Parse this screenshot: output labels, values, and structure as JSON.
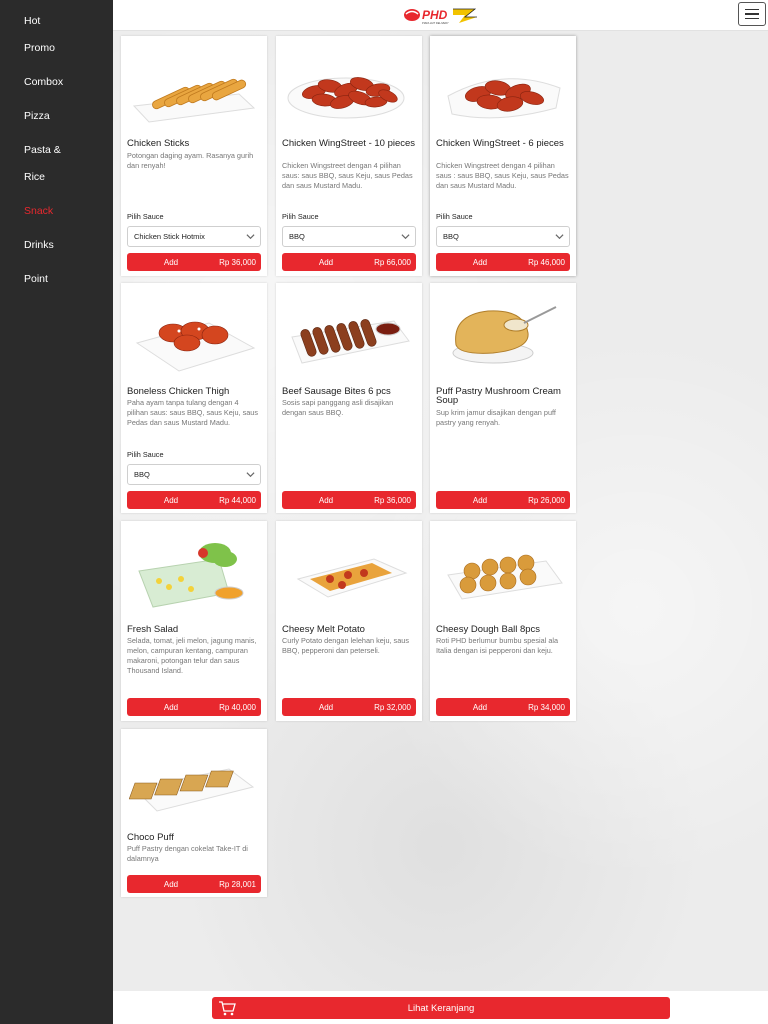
{
  "sidebar": {
    "items": [
      {
        "label": "Hot"
      },
      {
        "label": "Promo"
      },
      {
        "label": "Combox"
      },
      {
        "label": "Pizza"
      },
      {
        "label": "Pasta &"
      },
      {
        "label": "Rice"
      },
      {
        "label": "Snack",
        "active": true
      },
      {
        "label": "Drinks"
      },
      {
        "label": "Point"
      }
    ]
  },
  "header": {
    "logo_text": "PHD",
    "logo_tagline": "PIZZA HUT DELIVERY"
  },
  "products": [
    {
      "name": "Chicken Sticks",
      "desc": "Potongan daging ayam. Rasanya gurih dan renyah!",
      "sauce_label": "Pilih Sauce",
      "sauce": "Chicken Stick Hotmix",
      "add": "Add",
      "price": "Rp 36,000"
    },
    {
      "name": "Chicken WingStreet - 10 pieces",
      "desc": "Chicken Wingstreet dengan 4 pilihan saus: saus BBQ, saus Keju, saus Pedas dan saus Mustard Madu.",
      "sauce_label": "Pilih Sauce",
      "sauce": "BBQ",
      "add": "Add",
      "price": "Rp 66,000"
    },
    {
      "name": "Chicken WingStreet - 6 pieces",
      "desc": "Chicken Wingstreet dengan 4 pilihan saus : saus BBQ, saus Keju, saus Pedas dan saus Mustard Madu.",
      "sauce_label": "Pilih Sauce",
      "sauce": "BBQ",
      "add": "Add",
      "price": "Rp 46,000"
    },
    {
      "name": "Boneless Chicken Thigh",
      "desc": "Paha ayam tanpa tulang dengan 4 pilihan saus: saus BBQ, saus Keju, saus Pedas dan saus Mustard Madu.",
      "sauce_label": "Pilih Sauce",
      "sauce": "BBQ",
      "add": "Add",
      "price": "Rp 44,000"
    },
    {
      "name": "Beef Sausage Bites 6 pcs",
      "desc": "Sosis sapi panggang asli disajikan dengan saus BBQ.",
      "add": "Add",
      "price": "Rp 36,000"
    },
    {
      "name": "Puff Pastry Mushroom Cream Soup",
      "desc": "Sup krim jamur disajikan dengan puff pastry yang renyah.",
      "add": "Add",
      "price": "Rp 26,000"
    },
    {
      "name": "Fresh Salad",
      "desc": "Selada, tomat, jeli melon, jagung manis, melon, campuran kentang, campuran makaroni, potongan telur dan saus Thousand Island.",
      "add": "Add",
      "price": "Rp 40,000"
    },
    {
      "name": "Cheesy Melt Potato",
      "desc": "Curly Potato dengan lelehan keju, saus BBQ, pepperoni dan peterseli.",
      "add": "Add",
      "price": "Rp 32,000"
    },
    {
      "name": "Cheesy Dough Ball 8pcs",
      "desc": "Roti PHD berlumur bumbu spesial ala Italia dengan isi pepperoni dan keju.",
      "add": "Add",
      "price": "Rp 34,000"
    },
    {
      "name": "Choco Puff",
      "desc": "Puff Pastry dengan cokelat Take-IT di dalamnya",
      "add": "Add",
      "price": "Rp 28,001"
    }
  ],
  "footer": {
    "cart_label": "Lihat Keranjang"
  },
  "colors": {
    "accent": "#e8282e",
    "sidebar_bg": "#2b2b2b"
  }
}
